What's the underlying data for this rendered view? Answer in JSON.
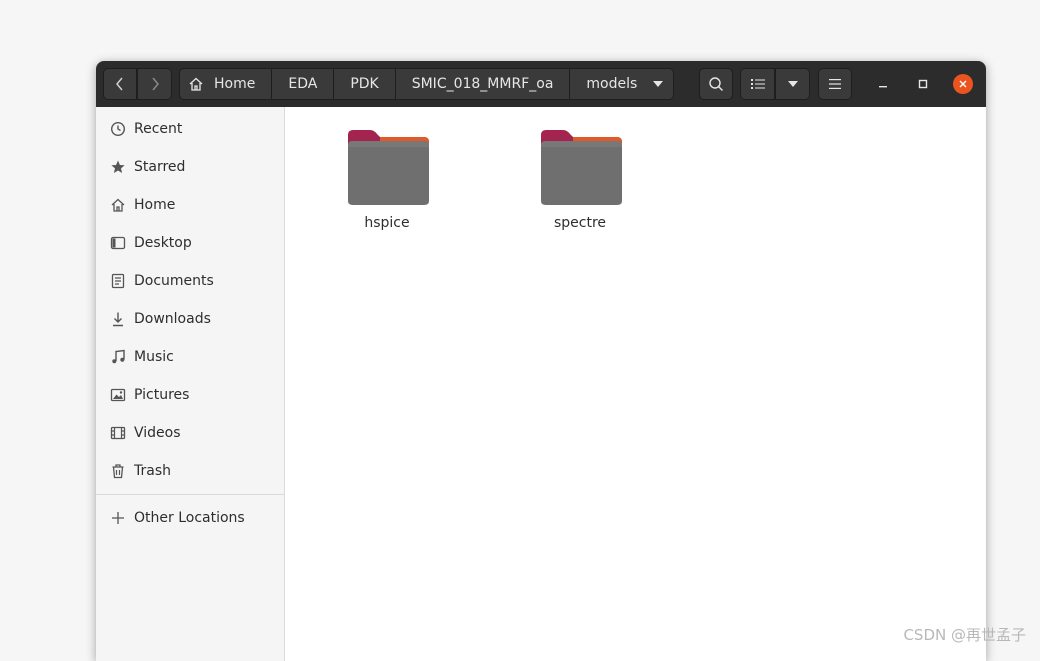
{
  "header": {
    "breadcrumbs": [
      "Home",
      "EDA",
      "PDK",
      "SMIC_018_MMRF_oa",
      "models"
    ]
  },
  "sidebar": {
    "items": [
      {
        "label": "Recent",
        "icon": "clock-icon"
      },
      {
        "label": "Starred",
        "icon": "star-icon"
      },
      {
        "label": "Home",
        "icon": "home-icon"
      },
      {
        "label": "Desktop",
        "icon": "desktop-icon"
      },
      {
        "label": "Documents",
        "icon": "document-icon"
      },
      {
        "label": "Downloads",
        "icon": "download-icon"
      },
      {
        "label": "Music",
        "icon": "music-icon"
      },
      {
        "label": "Pictures",
        "icon": "picture-icon"
      },
      {
        "label": "Videos",
        "icon": "video-icon"
      },
      {
        "label": "Trash",
        "icon": "trash-icon"
      }
    ],
    "other": {
      "label": "Other Locations",
      "icon": "plus-icon"
    }
  },
  "files": [
    {
      "name": "hspice",
      "type": "folder"
    },
    {
      "name": "spectre",
      "type": "folder"
    }
  ],
  "colors": {
    "headerbar": "#2c2c2c",
    "close_button": "#e95420",
    "folder_tab": "#a3244e",
    "folder_body": "#6f6f6f"
  },
  "watermark": "CSDN @再世孟子"
}
